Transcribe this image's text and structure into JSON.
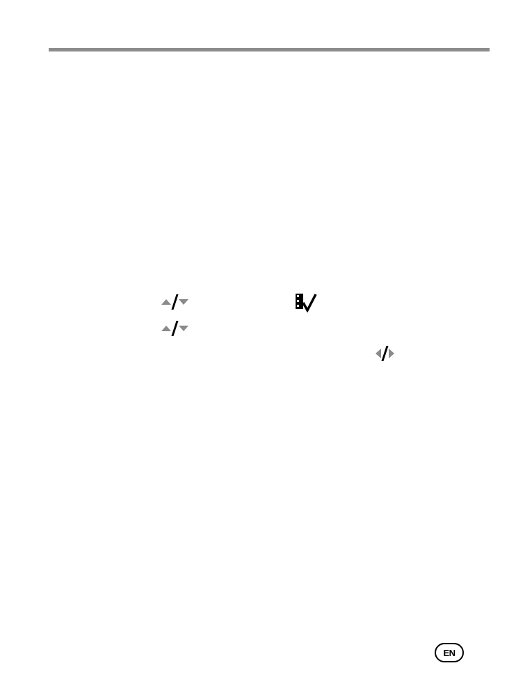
{
  "icons": {
    "nav_up_down_1": "up-down-arrows-icon",
    "review_check": "review-checkmark-icon",
    "nav_up_down_2": "up-down-arrows-icon",
    "nav_left_right": "left-right-arrows-icon"
  },
  "colors": {
    "rule": "#8c8c8c",
    "arrow": "#8a8a8a",
    "ink": "#000000"
  },
  "footer": {
    "language_badge": "EN"
  }
}
